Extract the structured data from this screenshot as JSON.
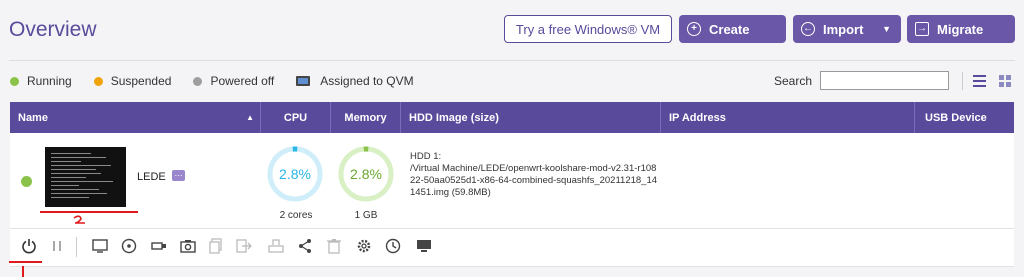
{
  "header": {
    "title": "Overview",
    "trial_button": "Try a free Windows® VM",
    "create_button": "Create",
    "import_button": "Import",
    "migrate_button": "Migrate"
  },
  "legend": {
    "running": "Running",
    "suspended": "Suspended",
    "powered_off": "Powered off",
    "assigned_qvm": "Assigned to QVM",
    "colors": {
      "running": "#8bc34a",
      "suspended": "#f0a30a",
      "powered_off": "#9e9e9e"
    }
  },
  "search": {
    "label": "Search",
    "value": ""
  },
  "table": {
    "columns": [
      "Name",
      "CPU",
      "Memory",
      "HDD Image (size)",
      "IP Address",
      "USB Device"
    ],
    "rows": [
      {
        "name": "LEDE",
        "status": "running",
        "cpu_percent": "2.8%",
        "cpu_cores": "2 cores",
        "mem_percent": "2.8%",
        "mem_total": "1 GB",
        "hdd_title": "HDD 1:",
        "hdd_path": "/Virtual Machine/LEDE/openwrt-koolshare-mod-v2.31-r10822-50aa0525d1-x86-64-combined-squashfs_20211218_141451.img (59.8MB)",
        "ip": "",
        "usb": ""
      }
    ]
  },
  "toolbar": {
    "icons": [
      "power-icon",
      "pause-icon",
      "console-icon",
      "cd-icon",
      "usb-icon",
      "snapshot-icon",
      "clone-icon",
      "export-icon",
      "reset-icon",
      "share-icon",
      "delete-icon",
      "settings-icon",
      "schedule-icon",
      "display-icon"
    ]
  },
  "colors": {
    "accent": "#5a4a9c",
    "gauge_cpu": "#29b6e8",
    "gauge_mem": "#8bc34a",
    "annotation": "#e0191b"
  }
}
